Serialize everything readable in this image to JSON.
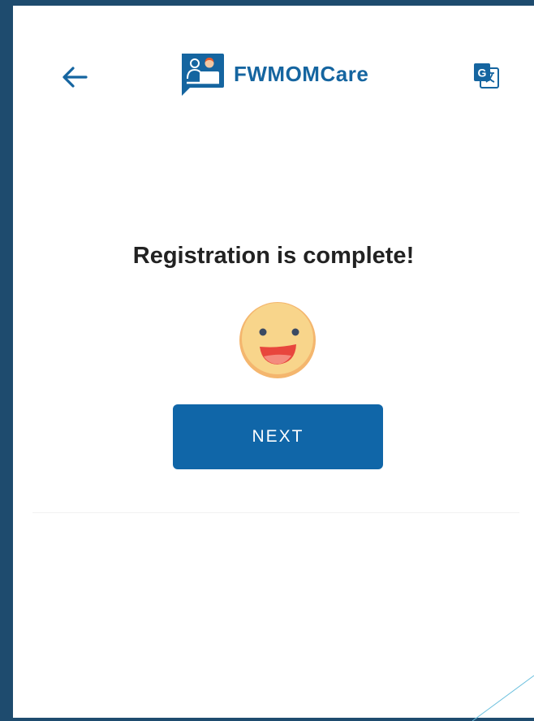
{
  "header": {
    "back_icon": "arrow-left-icon",
    "app_name": "FWMOMCare",
    "logo_icon": "fwmomcare-logo-icon",
    "translate_icon": "google-translate-icon"
  },
  "main": {
    "title": "Registration is complete!",
    "emoji_icon": "smiling-face-icon",
    "next_label": "NEXT"
  },
  "colors": {
    "brand": "#1565a0",
    "button": "#1066a8",
    "frame": "#1e4b6e",
    "title_text": "#222222",
    "emoji_face": "#f7cf7a",
    "emoji_mouth": "#e8463d"
  }
}
